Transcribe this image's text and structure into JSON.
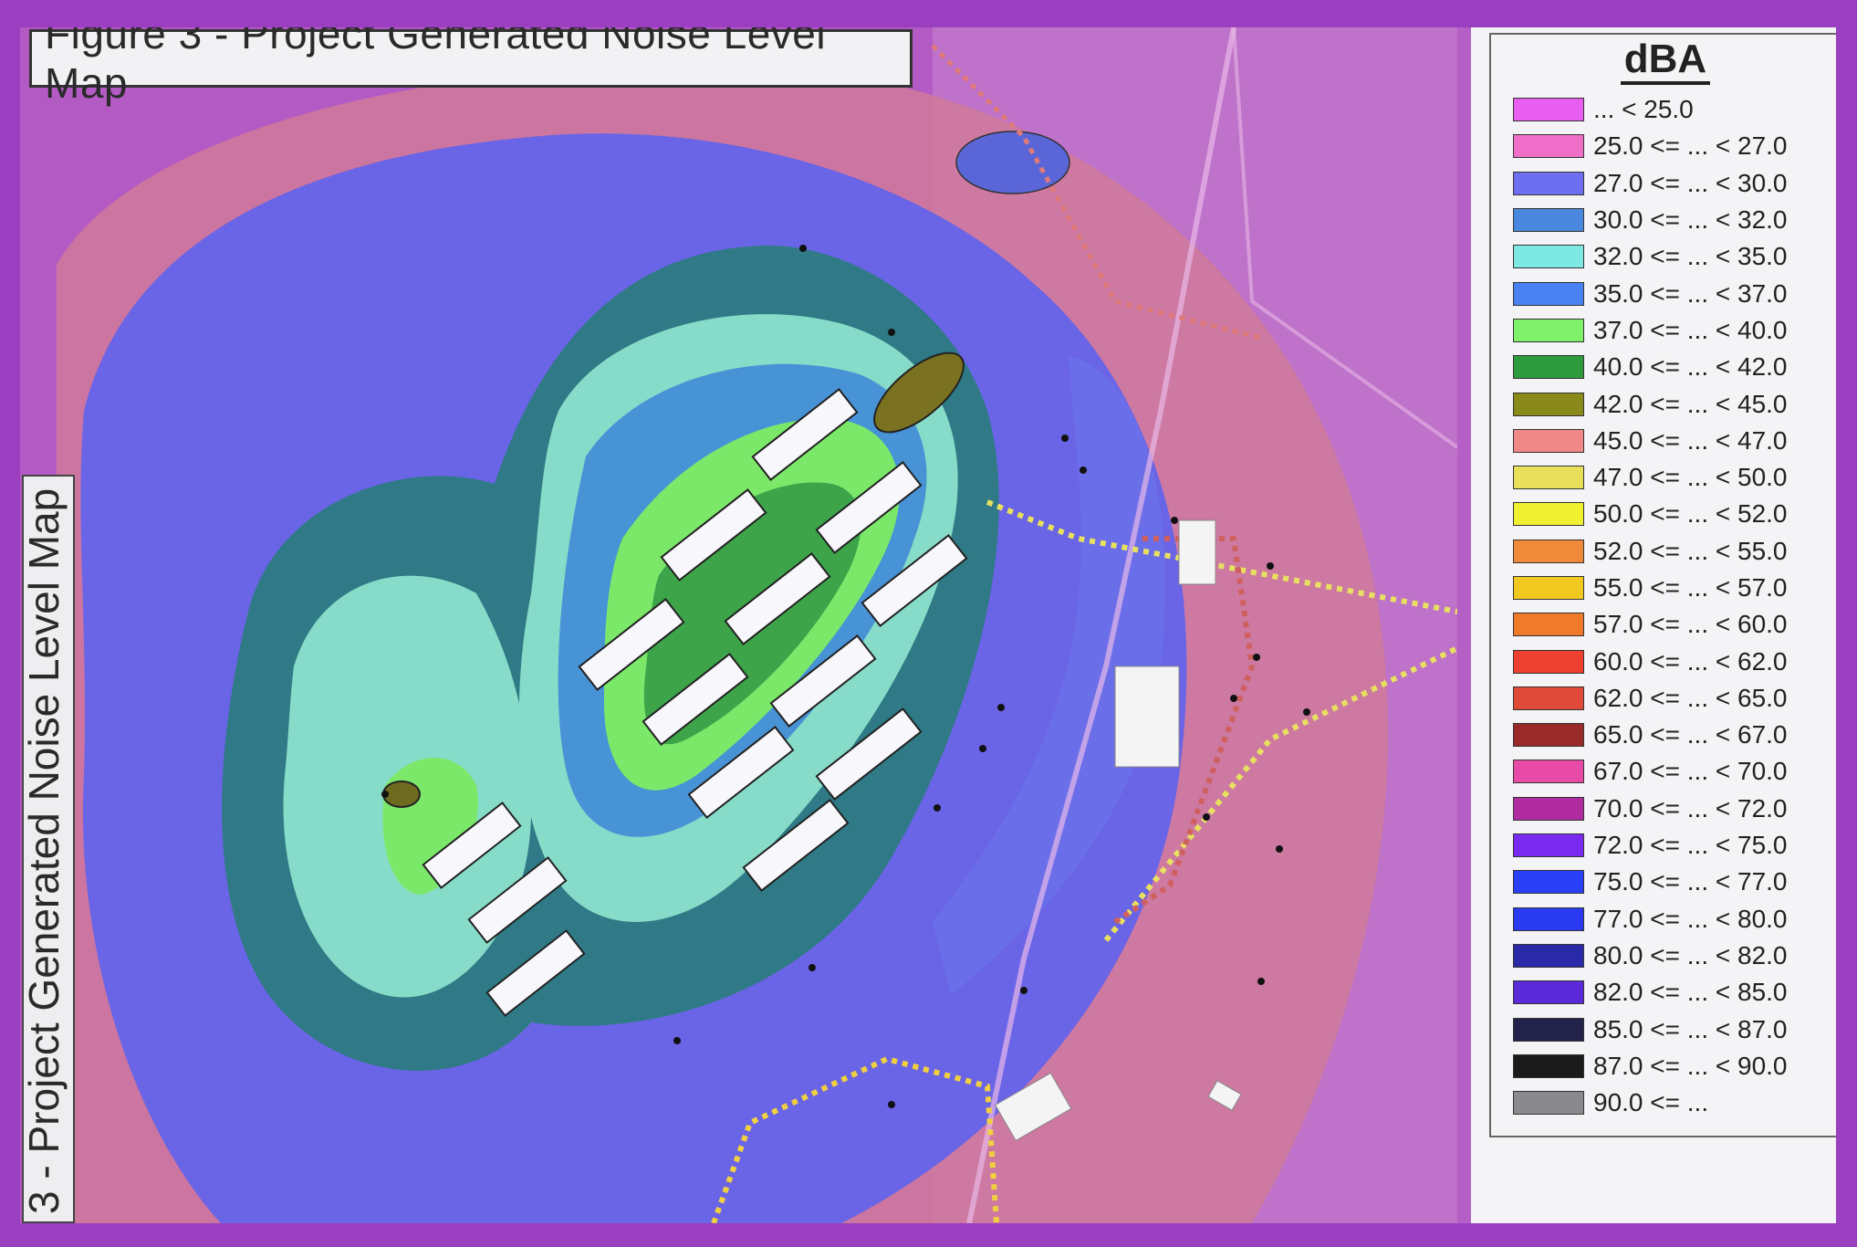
{
  "figure": {
    "title": "Figure 3 - Project Generated Noise Level Map",
    "side_title": "3 - Project Generated Noise Level Map"
  },
  "legend": {
    "title": "dBA",
    "items": [
      {
        "label": "... < 25.0",
        "color": "#e85ef0"
      },
      {
        "label": "25.0 <= ... < 27.0",
        "color": "#ee6ec8"
      },
      {
        "label": "27.0 <= ... < 30.0",
        "color": "#6e6ef2"
      },
      {
        "label": "30.0 <= ... < 32.0",
        "color": "#4a88e0"
      },
      {
        "label": "32.0 <= ... < 35.0",
        "color": "#7ee8e2"
      },
      {
        "label": "35.0 <= ... < 37.0",
        "color": "#4a82f4"
      },
      {
        "label": "37.0 <= ... < 40.0",
        "color": "#7ef06a"
      },
      {
        "label": "40.0 <= ... < 42.0",
        "color": "#2e9a3e"
      },
      {
        "label": "42.0 <= ... < 45.0",
        "color": "#8a8a1a"
      },
      {
        "label": "45.0 <= ... < 47.0",
        "color": "#f08888"
      },
      {
        "label": "47.0 <= ... < 50.0",
        "color": "#e8e05a"
      },
      {
        "label": "50.0 <= ... < 52.0",
        "color": "#f0f030"
      },
      {
        "label": "52.0 <= ... < 55.0",
        "color": "#f08a3a"
      },
      {
        "label": "55.0 <= ... < 57.0",
        "color": "#f0c820"
      },
      {
        "label": "57.0 <= ... < 60.0",
        "color": "#f07a2a"
      },
      {
        "label": "60.0 <= ... < 62.0",
        "color": "#ee4030"
      },
      {
        "label": "62.0 <= ... < 65.0",
        "color": "#e04a38"
      },
      {
        "label": "65.0 <= ... < 67.0",
        "color": "#9a2a2a"
      },
      {
        "label": "67.0 <= ... < 70.0",
        "color": "#e84aa8"
      },
      {
        "label": "70.0 <= ... < 72.0",
        "color": "#b02aa0"
      },
      {
        "label": "72.0 <= ... < 75.0",
        "color": "#7a2af0"
      },
      {
        "label": "75.0 <= ... < 77.0",
        "color": "#2a40f8"
      },
      {
        "label": "77.0 <= ... < 80.0",
        "color": "#2a3af0"
      },
      {
        "label": "80.0 <= ... < 82.0",
        "color": "#2a2aa8"
      },
      {
        "label": "82.0 <= ... < 85.0",
        "color": "#5a2ad8"
      },
      {
        "label": "85.0 <= ... < 87.0",
        "color": "#22224a"
      },
      {
        "label": "87.0 <= ... < 90.0",
        "color": "#1a1a1a"
      },
      {
        "label": "90.0 <= ...",
        "color": "#8a8a8e"
      }
    ]
  }
}
